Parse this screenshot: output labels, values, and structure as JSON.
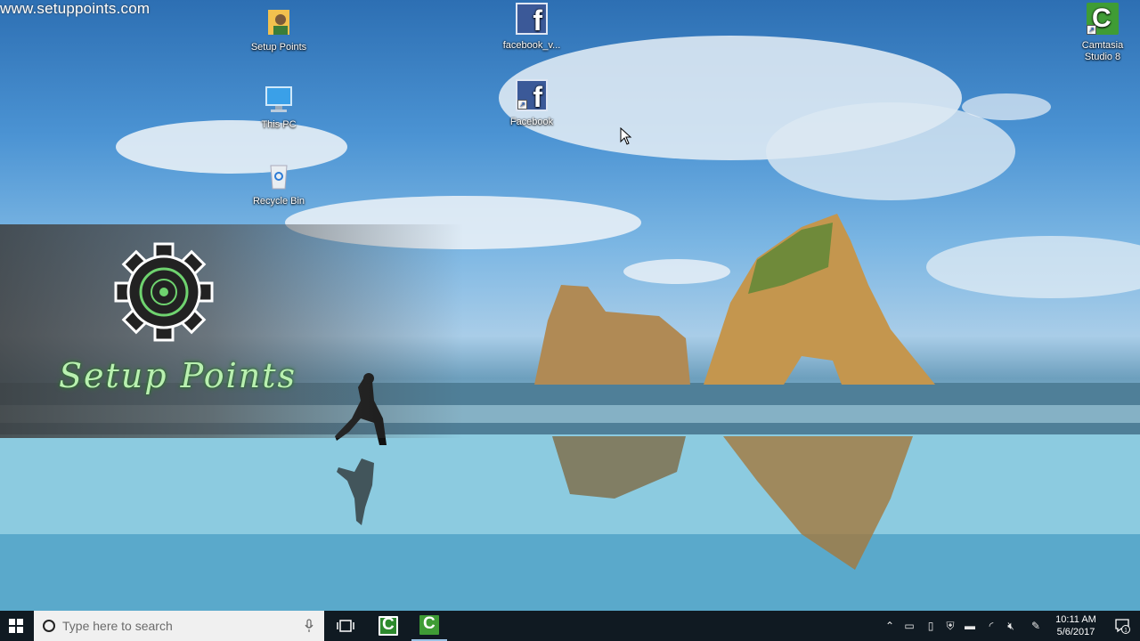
{
  "watermark": "www.setuppoints.com",
  "desktop_icons": {
    "setup_points": "Setup Points",
    "this_pc": "This PC",
    "recycle_bin": "Recycle Bin",
    "facebook_v": "facebook_v...",
    "facebook": "Facebook",
    "camtasia_line1": "Camtasia",
    "camtasia_line2": "Studio 8"
  },
  "brand_text": "Setup Points",
  "taskbar": {
    "search_placeholder": "Type here to search",
    "time": "10:11 AM",
    "date": "5/6/2017",
    "notification_count": "1"
  },
  "colors": {
    "taskbar": "#101a22",
    "facebook": "#3b5998",
    "camtasia": "#3f9c35"
  }
}
